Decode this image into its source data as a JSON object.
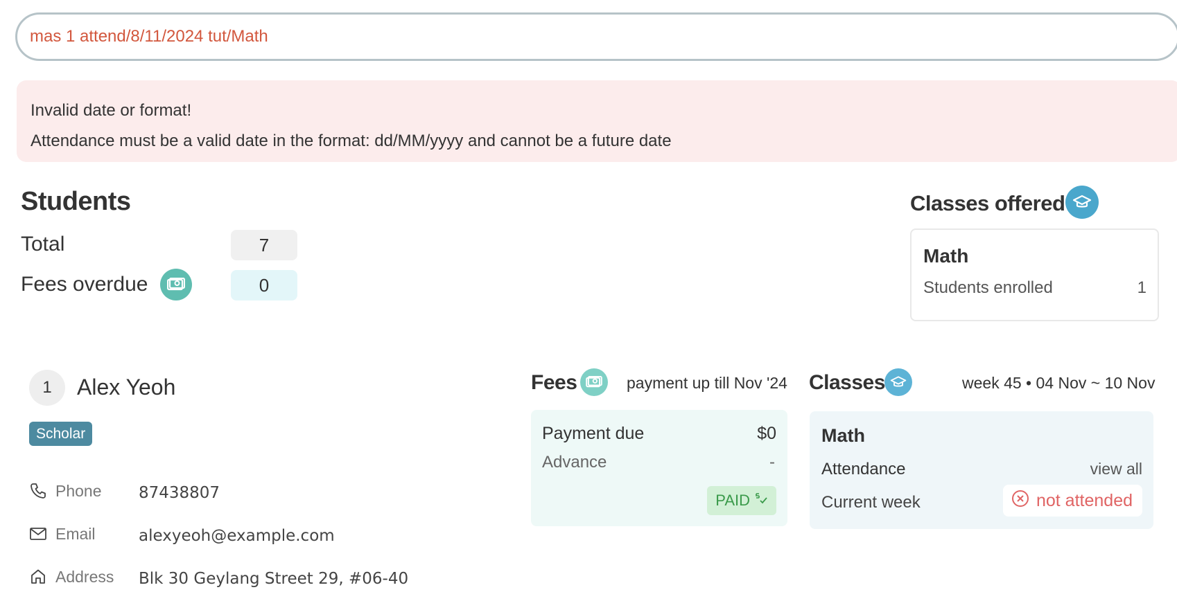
{
  "command": {
    "value": "mas 1 attend/8/11/2024 tut/Math"
  },
  "error": {
    "line1": "Invalid date or format!",
    "line2": "Attendance must be a valid date in the format: dd/MM/yyyy and cannot be a future date"
  },
  "students": {
    "title": "Students",
    "total_label": "Total",
    "total_value": "7",
    "fees_overdue_label": "Fees overdue",
    "fees_overdue_value": "0"
  },
  "classes_offered": {
    "title": "Classes offered",
    "items": [
      {
        "name": "Math",
        "label": "Students enrolled",
        "count": "1"
      }
    ]
  },
  "student": {
    "index": "1",
    "name": "Alex Yeoh",
    "tag": "Scholar",
    "phone_label": "Phone",
    "phone": "87438807",
    "email_label": "Email",
    "email": "alexyeoh@example.com",
    "address_label": "Address",
    "address": "Blk 30 Geylang Street 29, #06-40"
  },
  "fees": {
    "title": "Fees",
    "subtitle": "payment up till Nov '24",
    "payment_due_label": "Payment due",
    "payment_due_value": "$0",
    "advance_label": "Advance",
    "advance_value": "-",
    "status": "PAID"
  },
  "classes": {
    "title": "Classes",
    "subtitle": "week 45 • 04 Nov ~ 10 Nov",
    "class_name": "Math",
    "attendance_label": "Attendance",
    "view_all": "view all",
    "current_week_label": "Current week",
    "current_week_status": "not attended"
  },
  "colors": {
    "command_text": "#d2573d",
    "error_bg": "#fcecec",
    "teal_icon": "#5fbdb0",
    "blue_icon": "#4aa7cc",
    "tag_bg": "#4d8aa0",
    "paid_green": "#3a9a4a",
    "not_attended_red": "#e06464"
  },
  "icons": [
    "money-icon",
    "graduation-cap-icon",
    "phone-icon",
    "mail-icon",
    "home-icon",
    "paid-check-icon",
    "x-circle-icon"
  ]
}
